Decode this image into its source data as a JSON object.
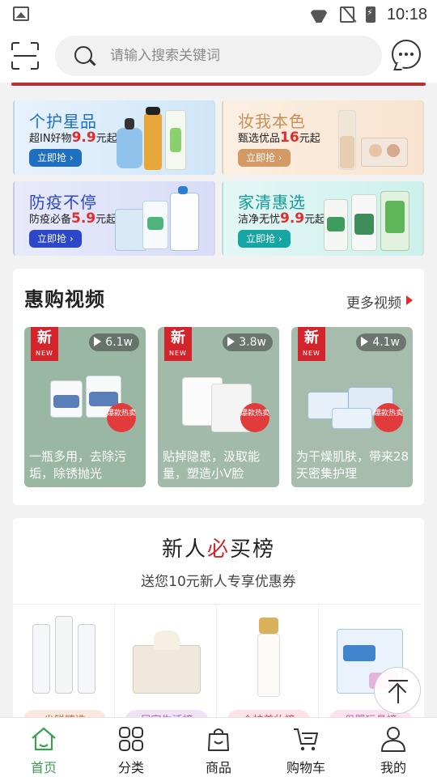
{
  "status_bar": {
    "time": "10:18"
  },
  "header": {
    "search_placeholder": "请输入搜索关键词"
  },
  "promos": [
    {
      "title": "个护星品",
      "sub_prefix": "超IN好物",
      "price": "9.9",
      "sub_suffix": "元起",
      "button": "立即抢",
      "title_color": "#1f6fc0",
      "button_color": "#1f6fc0"
    },
    {
      "title": "妆我本色",
      "sub_prefix": "甄选优品",
      "price": "16",
      "sub_suffix": "元起",
      "button": "立即抢",
      "title_color": "#c9915a",
      "button_color": "#d49a66"
    },
    {
      "title": "防疫不停",
      "sub_prefix": "防疫必备",
      "price": "5.9",
      "sub_suffix": "元起",
      "button": "立即抢",
      "title_color": "#2c47c9",
      "button_color": "#2c47c9"
    },
    {
      "title": "家清惠选",
      "sub_prefix": "洁净无忧",
      "price": "9.9",
      "sub_suffix": "元起",
      "button": "立即抢",
      "title_color": "#159c9a",
      "button_color": "#15a6a3"
    }
  ],
  "videos": {
    "title": "惠购视频",
    "more": "更多视频",
    "items": [
      {
        "badge_main": "新",
        "badge_sub": "NEW",
        "views": "6.1w",
        "hot": "爆款热卖",
        "caption": "一瓶多用，去除污垢，除锈抛光"
      },
      {
        "badge_main": "新",
        "badge_sub": "NEW",
        "views": "3.8w",
        "hot": "爆款热卖",
        "caption": "贴掉隐患，汲取能量，塑造小V脸"
      },
      {
        "badge_main": "新",
        "badge_sub": "NEW",
        "views": "4.1w",
        "hot": "爆款热卖",
        "caption": "为干燥肌肤，带来28天密集护理"
      }
    ]
  },
  "newcomer": {
    "title_a": "新人",
    "title_accent": "必",
    "title_b": "买榜",
    "subtitle": "送您10元新人专享优惠券",
    "tags": [
      "尖锐精选",
      "居家生活榜",
      "个护美妆榜",
      "母婴玩具榜"
    ]
  },
  "tabbar": {
    "items": [
      {
        "label": "首页",
        "active": true
      },
      {
        "label": "分类"
      },
      {
        "label": "商品"
      },
      {
        "label": "购物车"
      },
      {
        "label": "我的"
      }
    ]
  },
  "colors": {
    "accent_red": "#b33238",
    "active_green": "#3c9e52",
    "price_red": "#e02c2c"
  }
}
